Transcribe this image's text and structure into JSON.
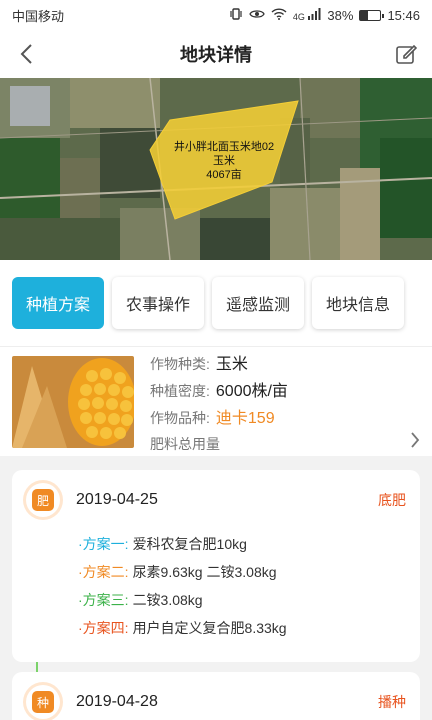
{
  "status_bar": {
    "carrier": "中国移动",
    "battery": "38%",
    "time": "15:46",
    "signal": "4G"
  },
  "nav": {
    "title": "地块详情"
  },
  "map": {
    "field_name": "井小胖北面玉米地02",
    "crop": "玉米",
    "area": "4067亩"
  },
  "tabs": [
    {
      "label": "种植方案",
      "active": true
    },
    {
      "label": "农事操作",
      "active": false
    },
    {
      "label": "遥感监测",
      "active": false
    },
    {
      "label": "地块信息",
      "active": false
    }
  ],
  "crop_info": {
    "type_label": "作物种类:",
    "type_value": "玉米",
    "density_label": "种植密度:",
    "density_value": "6000株/亩",
    "variety_label": "作物品种:",
    "variety_value": "迪卡159",
    "fertilizer_label": "肥料总用量"
  },
  "plans": [
    {
      "badge": "肥",
      "date": "2019-04-25",
      "tag": "底肥",
      "schemes": [
        {
          "label": "·方案一:",
          "color": "#1eb0dc",
          "text": "爱科农复合肥10kg"
        },
        {
          "label": "·方案二:",
          "color": "#f08a24",
          "text": "尿素9.63kg 二铵3.08kg"
        },
        {
          "label": "·方案三:",
          "color": "#3cb24a",
          "text": "二铵3.08kg"
        },
        {
          "label": "·方案四:",
          "color": "#e8541f",
          "text": "用户自定义复合肥8.33kg"
        }
      ]
    },
    {
      "badge": "种",
      "date": "2019-04-28",
      "tag": "播种"
    }
  ],
  "colors": {
    "accent": "#1eb0dc",
    "orange": "#f08a24",
    "tag_red": "#e8541f",
    "timeline_green": "#7bd36a"
  }
}
